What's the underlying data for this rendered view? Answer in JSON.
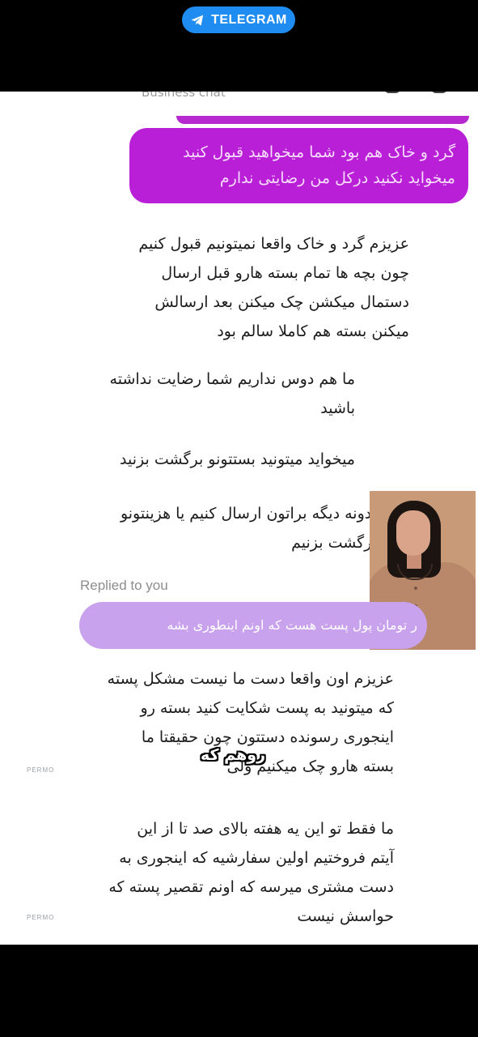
{
  "app": {
    "badge_label": "TELEGRAM",
    "badge_icon": "telegram-plane-icon",
    "accent_color": "#1e8cf0"
  },
  "chat": {
    "header_label": "Business chat",
    "outgoing_color": "#b91fd6",
    "outgoing": {
      "lines": [
        "گرد و خاک هم بود شما میخواهید قبول کنید",
        "میخواید نکنید درکل من رضایتی ندارم"
      ]
    },
    "incoming": [
      {
        "lines": [
          "عزیزم گرد و خاک واقعا نمیتونیم قبول کنیم",
          "چون بچه ها تمام بسته هارو قبل ارسال",
          "دستمال میکشن چک میکنن بعد ارسالش",
          "میکنن بسته هم کاملا سالم بود"
        ]
      },
      {
        "lines": [
          "ما هم دوس نداریم شما رضایت نداشته",
          "باشید"
        ]
      },
      {
        "lines": [
          "میخواید میتونید بستتونو برگشت بزنید"
        ]
      },
      {
        "lines": [
          "یدونه دیگه براتون ارسال کنیم یا هزینتونو",
          "برگشت بزنیم"
        ]
      }
    ],
    "reply": {
      "replied_label": "Replied to you",
      "quoted_text": "ر تومان پول پست هست که اونم اینطوری بشه"
    },
    "incoming_after_reply": [
      {
        "lines": [
          "عزیزم اون واقعا دست ما نیست مشکل پسته",
          "که میتونید به پست شکایت کنید بسته رو",
          "اینجوری رسونده دستتون چون حقیقتا ما",
          "بسته هارو چک میکنیم ولی"
        ]
      },
      {
        "lines": [
          "ما فقط تو این یه هفته بالای صد تا از این",
          "آیتم فروختیم اولین سفارشیه که اینجوری به",
          "دست مشتری میرسه که اونم تقصیر پسته که",
          "حواسش نیست"
        ]
      }
    ]
  },
  "overlay": {
    "caption": "روهم که",
    "watermark": "PERMO"
  }
}
